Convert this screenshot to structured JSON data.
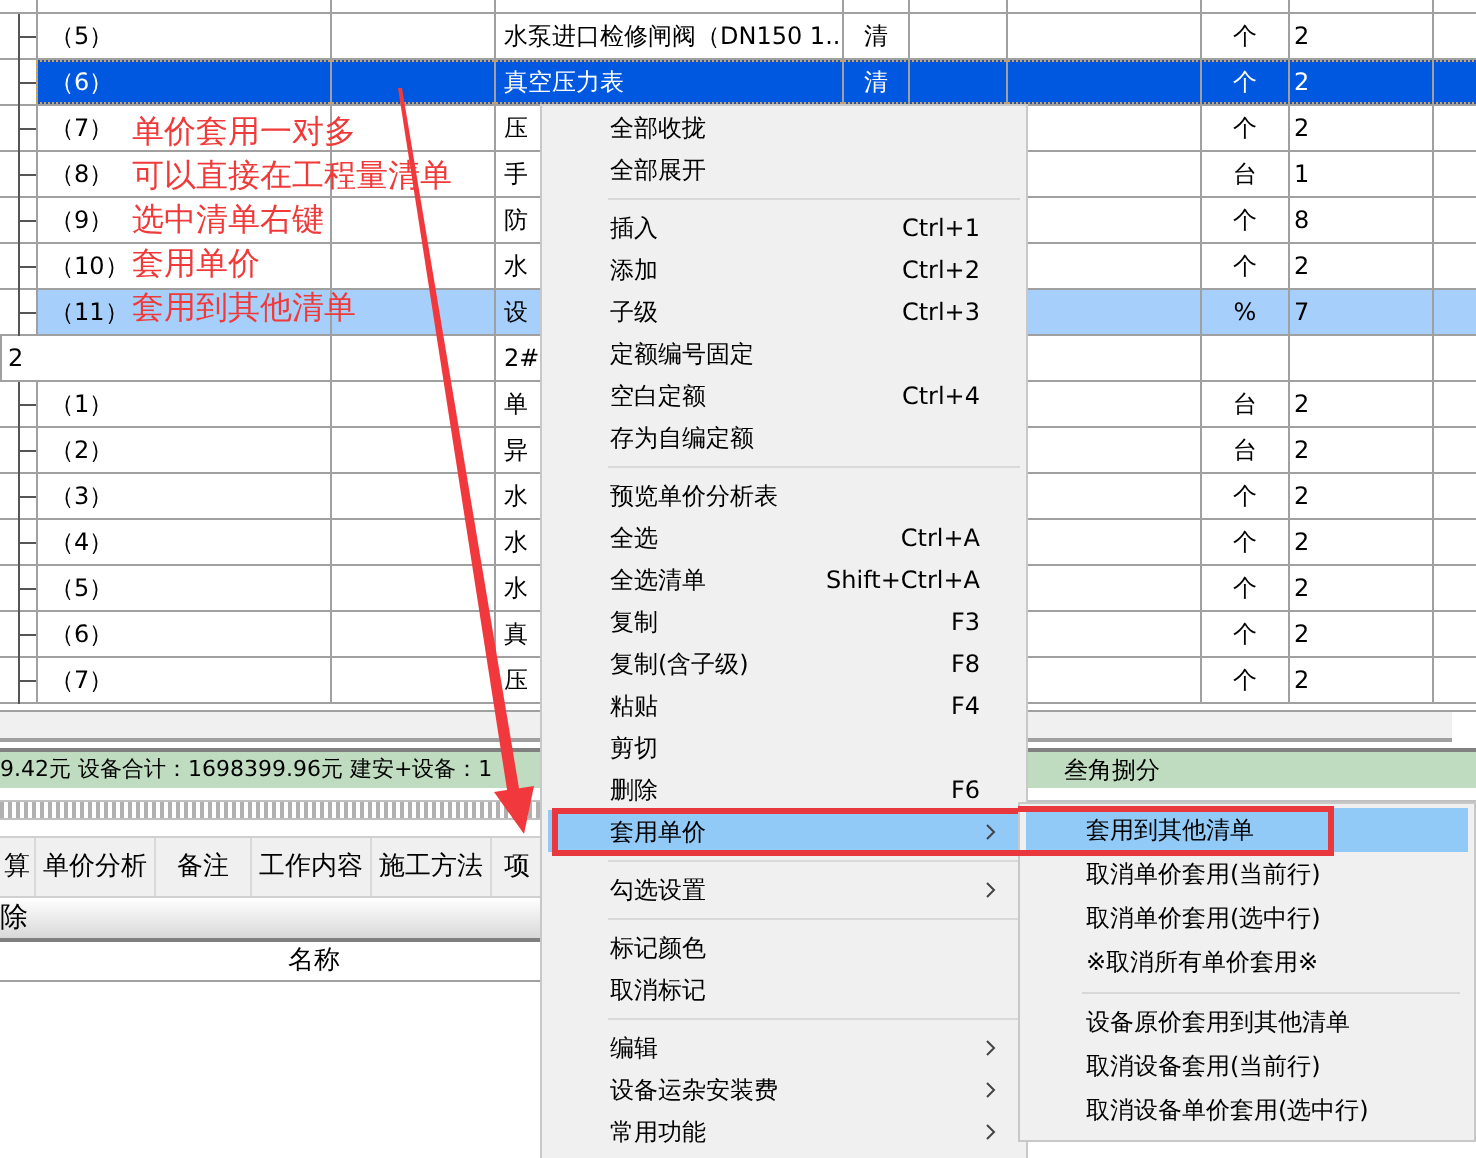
{
  "table": {
    "rows": [
      {
        "kind": "blank"
      },
      {
        "kind": "item",
        "seq": "（5）",
        "name": "水泵进口检修闸阀（DN150 1...",
        "type": "清",
        "unit": "个",
        "qty": "2",
        "current": false,
        "selected": false
      },
      {
        "kind": "item",
        "seq": "（6）",
        "name": "真空压力表",
        "type": "清",
        "unit": "个",
        "qty": "2",
        "current": true,
        "selected": true
      },
      {
        "kind": "item",
        "seq": "（7）",
        "name": "压",
        "unit": "个",
        "qty": "2",
        "current": false,
        "selected": false
      },
      {
        "kind": "item",
        "seq": "（8）",
        "name": "手",
        "unit": "台",
        "qty": "1",
        "current": false,
        "selected": false
      },
      {
        "kind": "item",
        "seq": "（9）",
        "name": "防",
        "unit": "个",
        "qty": "8",
        "current": false,
        "selected": false
      },
      {
        "kind": "item",
        "seq": "（10）",
        "name": "水",
        "unit": "个",
        "qty": "2",
        "current": false,
        "selected": false
      },
      {
        "kind": "item",
        "seq": "（11）",
        "name": "设",
        "unit": "%",
        "qty": "7",
        "current": false,
        "selected": true
      },
      {
        "kind": "group",
        "seq": "2",
        "name": "2#"
      },
      {
        "kind": "item",
        "seq": "（1）",
        "name": "单",
        "unit": "台",
        "qty": "2",
        "current": false,
        "selected": false
      },
      {
        "kind": "item",
        "seq": "（2）",
        "name": "异",
        "unit": "台",
        "qty": "2",
        "current": false,
        "selected": false
      },
      {
        "kind": "item",
        "seq": "（3）",
        "name": "水",
        "unit": "个",
        "qty": "2",
        "current": false,
        "selected": false
      },
      {
        "kind": "item",
        "seq": "（4）",
        "name": "水",
        "unit": "个",
        "qty": "2",
        "current": false,
        "selected": false
      },
      {
        "kind": "item",
        "seq": "（5）",
        "name": "水",
        "unit": "个",
        "qty": "2",
        "current": false,
        "selected": false
      },
      {
        "kind": "item",
        "seq": "（6）",
        "name": "真",
        "unit": "个",
        "qty": "2",
        "current": false,
        "selected": false
      },
      {
        "kind": "item",
        "seq": "（7）",
        "name": "压",
        "unit": "个",
        "qty": "2",
        "current": false,
        "selected": false
      }
    ]
  },
  "annotations": [
    "单价套用一对多",
    "可以直接在工程量清单",
    "选中清单右键",
    "套用单价",
    "套用到其他清单"
  ],
  "status_bar": {
    "left": "9.42元 设备合计：1698399.96元 建安+设备：1",
    "right": "叁角捌分"
  },
  "tabs": [
    {
      "label": "算"
    },
    {
      "label": "单价分析"
    },
    {
      "label": "备注"
    },
    {
      "label": "工作内容"
    },
    {
      "label": "施工方法"
    },
    {
      "label": "项"
    }
  ],
  "subtoolbar": {
    "label": "除"
  },
  "detail_header": {
    "column": "名称"
  },
  "context_menu": {
    "items": [
      {
        "kind": "item",
        "label": "全部收拢",
        "has_submenu": false,
        "selected": false
      },
      {
        "kind": "item",
        "label": "全部展开",
        "has_submenu": false,
        "selected": false
      },
      {
        "kind": "separator"
      },
      {
        "kind": "item",
        "label": "插入",
        "shortcut": "Ctrl+1",
        "has_submenu": false,
        "selected": false
      },
      {
        "kind": "item",
        "label": "添加",
        "shortcut": "Ctrl+2",
        "has_submenu": false,
        "selected": false
      },
      {
        "kind": "item",
        "label": "子级",
        "shortcut": "Ctrl+3",
        "has_submenu": false,
        "selected": false
      },
      {
        "kind": "item",
        "label": "定额编号固定",
        "has_submenu": false,
        "selected": false
      },
      {
        "kind": "item",
        "label": "空白定额",
        "shortcut": "Ctrl+4",
        "has_submenu": false,
        "selected": false
      },
      {
        "kind": "item",
        "label": "存为自编定额",
        "has_submenu": false,
        "selected": false
      },
      {
        "kind": "separator"
      },
      {
        "kind": "item",
        "label": "预览单价分析表",
        "has_submenu": false,
        "selected": false
      },
      {
        "kind": "item",
        "label": "全选",
        "shortcut": "Ctrl+A",
        "has_submenu": false,
        "selected": false
      },
      {
        "kind": "item",
        "label": "全选清单",
        "shortcut": "Shift+Ctrl+A",
        "has_submenu": false,
        "selected": false
      },
      {
        "kind": "item",
        "label": "复制",
        "shortcut": "F3",
        "has_submenu": false,
        "selected": false
      },
      {
        "kind": "item",
        "label": "复制(含子级)",
        "shortcut": "F8",
        "has_submenu": false,
        "selected": false
      },
      {
        "kind": "item",
        "label": "粘贴",
        "shortcut": "F4",
        "has_submenu": false,
        "selected": false
      },
      {
        "kind": "item",
        "label": "剪切",
        "has_submenu": false,
        "selected": false
      },
      {
        "kind": "item",
        "label": "删除",
        "shortcut": "F6",
        "has_submenu": false,
        "selected": false
      },
      {
        "kind": "item",
        "label": "套用单价",
        "has_submenu": true,
        "selected": true
      },
      {
        "kind": "separator"
      },
      {
        "kind": "item",
        "label": "勾选设置",
        "has_submenu": true,
        "selected": false
      },
      {
        "kind": "separator"
      },
      {
        "kind": "item",
        "label": "标记颜色",
        "has_submenu": false,
        "selected": false
      },
      {
        "kind": "item",
        "label": "取消标记",
        "has_submenu": false,
        "selected": false
      },
      {
        "kind": "separator"
      },
      {
        "kind": "item",
        "label": "编辑",
        "has_submenu": true,
        "selected": false
      },
      {
        "kind": "item",
        "label": "设备运杂安装费",
        "has_submenu": true,
        "selected": false
      },
      {
        "kind": "item",
        "label": "常用功能",
        "has_submenu": true,
        "selected": false
      }
    ]
  },
  "submenu": {
    "items": [
      {
        "kind": "item",
        "label": "套用到其他清单",
        "selected": true
      },
      {
        "kind": "item",
        "label": "取消单价套用(当前行)",
        "selected": false
      },
      {
        "kind": "item",
        "label": "取消单价套用(选中行)",
        "selected": false
      },
      {
        "kind": "item",
        "label": "※取消所有单价套用※",
        "selected": false
      },
      {
        "kind": "separator"
      },
      {
        "kind": "item",
        "label": "设备原价套用到其他清单",
        "selected": false
      },
      {
        "kind": "item",
        "label": "取消设备套用(当前行)",
        "selected": false
      },
      {
        "kind": "item",
        "label": "取消设备单价套用(选中行)",
        "selected": false
      }
    ]
  }
}
